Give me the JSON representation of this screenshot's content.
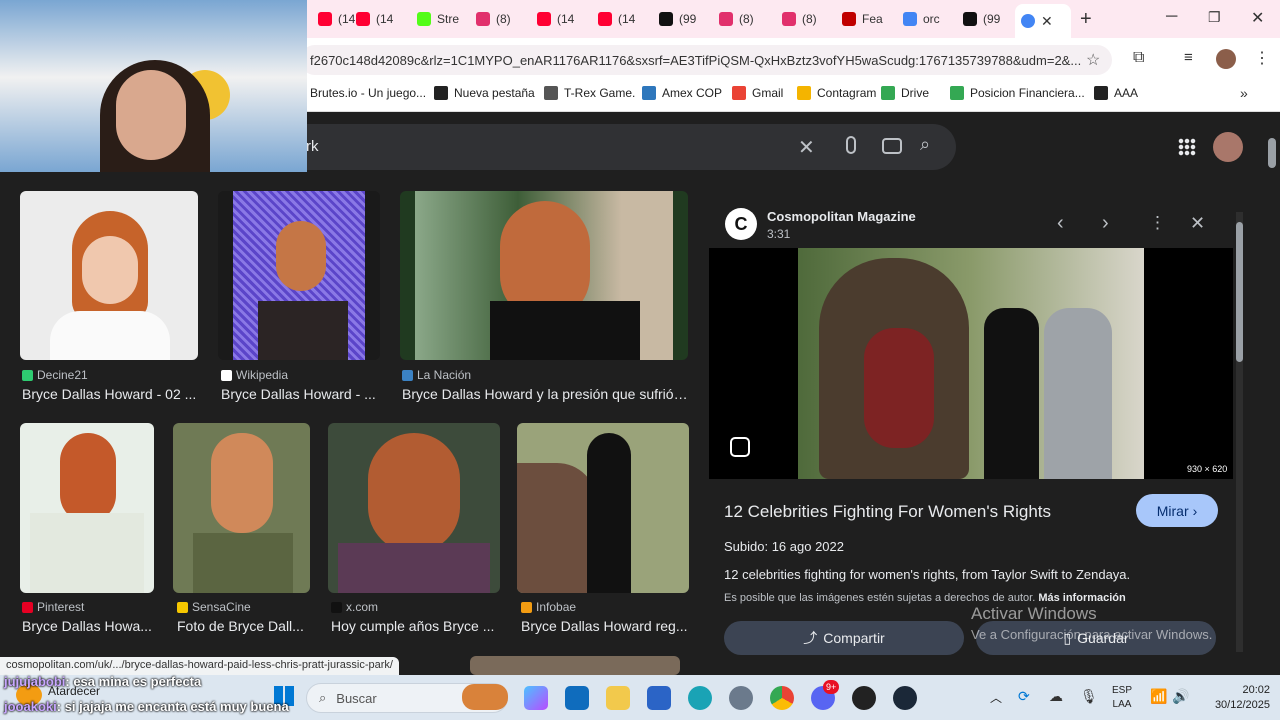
{
  "browser": {
    "tabs": [
      {
        "label": "(14",
        "color": "#ff0033"
      },
      {
        "label": "(14",
        "color": "#ff0033"
      },
      {
        "label": "Stre",
        "color": "#53fc18"
      },
      {
        "label": "(8)",
        "color": "#e1306c"
      },
      {
        "label": "(14",
        "color": "#ff0033"
      },
      {
        "label": "(14",
        "color": "#ff0033"
      },
      {
        "label": "(99",
        "color": "#111111"
      },
      {
        "label": "(8)",
        "color": "#e1306c"
      },
      {
        "label": "(8)",
        "color": "#e1306c"
      },
      {
        "label": "Fea",
        "color": "#c00000"
      },
      {
        "label": "orc",
        "color": "#4285f4"
      },
      {
        "label": "(99",
        "color": "#111111"
      }
    ],
    "url": "f2670c148d42089c&rlz=1C1MYPO_enAR1176AR1176&sxsrf=AE3TifPiQSM-QxHxBztz3vofYH5waScudg:1767135739788&udm=2&...",
    "bookmarks": [
      {
        "label": "Brutes.io - Un juego...",
        "color": "#888"
      },
      {
        "label": "Nueva pestaña",
        "color": "#222"
      },
      {
        "label": "T-Rex Game.",
        "color": "#555"
      },
      {
        "label": "Amex COP",
        "color": "#2e77bc"
      },
      {
        "label": "Gmail",
        "color": "#ea4335"
      },
      {
        "label": "Contagram",
        "color": "#f4b400"
      },
      {
        "label": "Drive",
        "color": "#34a853"
      },
      {
        "label": "Posicion Financiera...",
        "color": "#34a853"
      },
      {
        "label": "AAA",
        "color": "#222"
      }
    ]
  },
  "search": {
    "query": "rk"
  },
  "results": [
    {
      "source": "Decine21",
      "title": "Bryce Dallas Howard - 02 ...",
      "color": "#2ecc71"
    },
    {
      "source": "Wikipedia",
      "title": "Bryce Dallas Howard - ...",
      "color": "#ffffff"
    },
    {
      "source": "La Nación",
      "title": "Bryce Dallas Howard y la presión que sufrió ...",
      "color": "#3b82c4"
    },
    {
      "source": "Pinterest",
      "title": "Bryce Dallas Howa...",
      "color": "#e60023"
    },
    {
      "source": "SensaCine",
      "title": "Foto de Bryce Dall...",
      "color": "#f6c700"
    },
    {
      "source": "x.com",
      "title": "Hoy cumple años Bryce ...",
      "color": "#111111"
    },
    {
      "source": "Infobae",
      "title": "Bryce Dallas Howard reg...",
      "color": "#f39c12"
    }
  ],
  "panel": {
    "publisher": "Cosmopolitan Magazine",
    "duration": "3:31",
    "dimensions": "930 × 620",
    "title": "12 Celebrities Fighting For Women's Rights",
    "watch": "Mirar",
    "uploaded": "Subido: 16 ago 2022",
    "description": "12 celebrities fighting for women's rights, from Taylor Swift to Zendaya.",
    "copyright": "Es posible que las imágenes estén sujetas a derechos de autor.",
    "more_info": "Más información",
    "share": "Compartir",
    "save": "Guardar"
  },
  "status_url": "cosmopolitan.com/uk/.../bryce-dallas-howard-paid-less-chris-pratt-jurassic-park/",
  "chat": [
    {
      "user": "jujujabobi",
      "text": ": esa mina es perfecta"
    },
    {
      "user": "jooakoki",
      "text": ": si jajaja me encanta está muy buena"
    }
  ],
  "windows_watermark": {
    "title": "Activar Windows",
    "subtitle": "Ve a Configuración para activar Windows."
  },
  "taskbar": {
    "weather": "Atardecer",
    "search_placeholder": "Buscar",
    "lang": "ESP",
    "region": "LAA",
    "time": "20:02",
    "date": "30/12/2025",
    "discord_badge": "9+"
  }
}
